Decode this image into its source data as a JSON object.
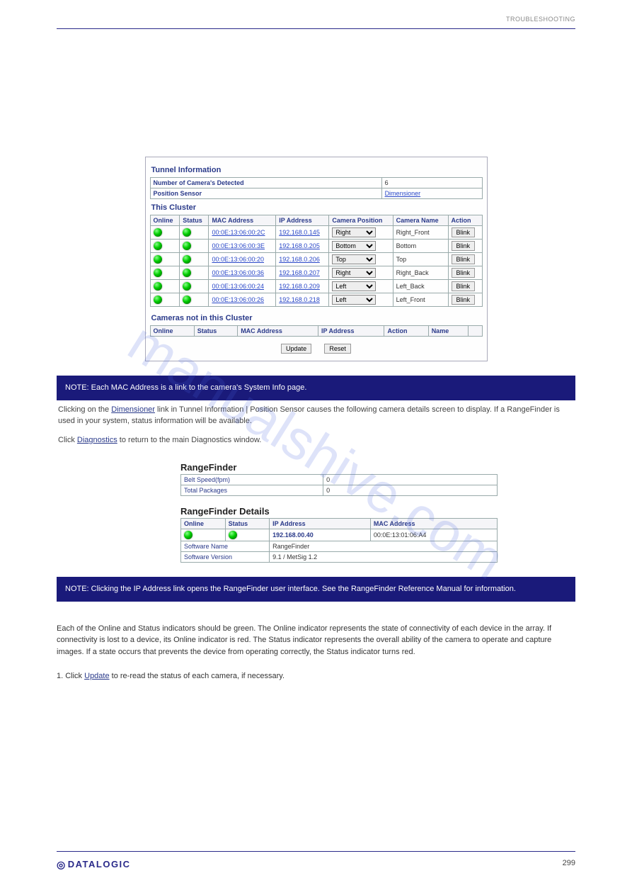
{
  "header": {
    "right_text": "TROUBLESHOOTING"
  },
  "watermark": "manualshive.com",
  "panel1": {
    "tunnel_title": "Tunnel Information",
    "rows": [
      {
        "label": "Number of Camera's Detected",
        "value": "6"
      },
      {
        "label": "Position Sensor",
        "value": "Dimensioner",
        "is_link": true
      }
    ],
    "cluster_title": "This Cluster",
    "columns": [
      "Online",
      "Status",
      "MAC Address",
      "IP Address",
      "Camera Position",
      "Camera Name",
      "Action"
    ],
    "rows_cluster": [
      {
        "mac": "00:0E:13:06:00:2C",
        "ip": "192.168.0.145",
        "pos": "Right",
        "name": "Right_Front",
        "action": "Blink"
      },
      {
        "mac": "00:0E:13:06:00:3E",
        "ip": "192.168.0.205",
        "pos": "Bottom",
        "name": "Bottom",
        "action": "Blink"
      },
      {
        "mac": "00:0E:13:06:00:20",
        "ip": "192.168.0.206",
        "pos": "Top",
        "name": "Top",
        "action": "Blink"
      },
      {
        "mac": "00:0E:13:06:00:36",
        "ip": "192.168.0.207",
        "pos": "Right",
        "name": "Right_Back",
        "action": "Blink"
      },
      {
        "mac": "00:0E:13:06:00:24",
        "ip": "192.168.0.209",
        "pos": "Left",
        "name": "Left_Back",
        "action": "Blink"
      },
      {
        "mac": "00:0E:13:06:00:26",
        "ip": "192.168.0.218",
        "pos": "Left",
        "name": "Left_Front",
        "action": "Blink"
      }
    ],
    "not_cluster_title": "Cameras not in this Cluster",
    "not_cluster_columns": [
      "Online",
      "Status",
      "MAC Address",
      "IP Address",
      "Action",
      "Name"
    ],
    "update_label": "Update",
    "reset_label": "Reset"
  },
  "note1": {
    "bar": "NOTE: Each MAC Address is a link to the camera's System Info page.",
    "after1_a": "Clicking on the ",
    "after1_link": "Dimensioner",
    "after1_b": " link in Tunnel Information | Position Sensor causes the following camera details screen to display. If a RangeFinder is used in your system, status information will be available.",
    "after2_a": "Click ",
    "after2_link": "Diagnostics",
    "after2_b": " to return to the main Diagnostics window."
  },
  "rf": {
    "title1": "RangeFinder",
    "kv": [
      {
        "label": "Belt Speed(fpm)",
        "value": "0"
      },
      {
        "label": "Total Packages",
        "value": "0"
      }
    ],
    "title2": "RangeFinder Details",
    "columns": [
      "Online",
      "Status",
      "IP Address",
      "MAC Address"
    ],
    "row": {
      "ip": "192.168.00.40",
      "mac": "00:0E:13:01:06:A4"
    },
    "sw": [
      {
        "label": "Software Name",
        "value": "RangeFinder"
      },
      {
        "label": "Software Version",
        "value": "9.1 / MetSig 1.2"
      }
    ]
  },
  "note2": {
    "bar": "NOTE: Clicking the IP Address link opens the RangeFinder user interface. See the RangeFinder Reference Manual for information.",
    "body": "Each of the Online and Status indicators should be green. The Online indicator represents the state of connectivity of each device in the array. If connectivity is lost to a device, its Online indicator is red. The Status indicator represents the overall ability of the camera to operate and capture images. If a state occurs that prevents the device from operating correctly, the Status indicator turns red.",
    "list1_a": "1. Click ",
    "list1_link": "Update",
    "list1_b": " to re-read the status of each camera, if necessary."
  },
  "footer": {
    "logo": "DATALOGIC",
    "page": "299"
  }
}
